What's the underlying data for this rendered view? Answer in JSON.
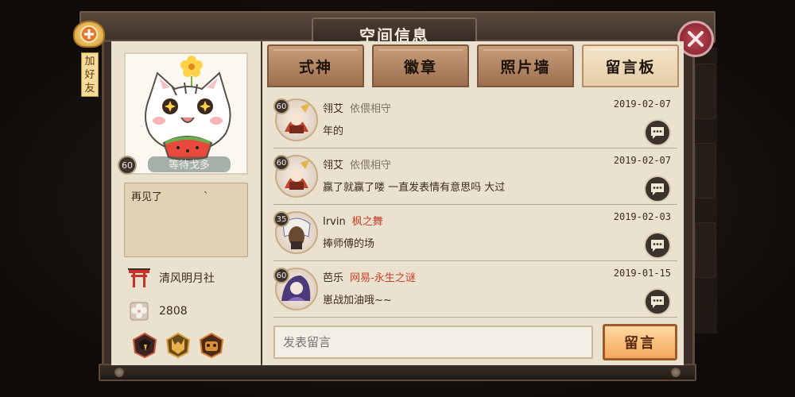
{
  "window": {
    "title": "空间信息"
  },
  "add_friend": {
    "label": "加好友"
  },
  "tabs": [
    {
      "label": "式神",
      "active": false
    },
    {
      "label": "徽章",
      "active": false
    },
    {
      "label": "照片墙",
      "active": false
    },
    {
      "label": "留言板",
      "active": true
    }
  ],
  "profile": {
    "level": "60",
    "name": "等待戈多",
    "signature": "再见了　　　　`",
    "guild": "清风明月社",
    "currency": "2808"
  },
  "messages": [
    {
      "level": "60",
      "name": "翎艾",
      "guild": "依偎相守",
      "guild_color": "gray",
      "date": "2019-02-07",
      "text": "年的"
    },
    {
      "level": "60",
      "name": "翎艾",
      "guild": "依偎相守",
      "guild_color": "gray",
      "date": "2019-02-07",
      "text": "赢了就赢了喽 一直发表情有意思吗 大过"
    },
    {
      "level": "35",
      "name": "Irvin",
      "guild": "枫之舞",
      "guild_color": "red",
      "date": "2019-02-03",
      "text": "捧师傅的场"
    },
    {
      "level": "60",
      "name": "芭乐",
      "guild": "网易-永生之谜",
      "guild_color": "red",
      "date": "2019-01-15",
      "text": "崽战加油哦~~"
    }
  ],
  "compose": {
    "placeholder": "发表留言",
    "button_label": "留言"
  },
  "colors": {
    "accent_red": "#c8412a",
    "tab_active": "#f4e3c7",
    "panel": "#eae1cf"
  }
}
